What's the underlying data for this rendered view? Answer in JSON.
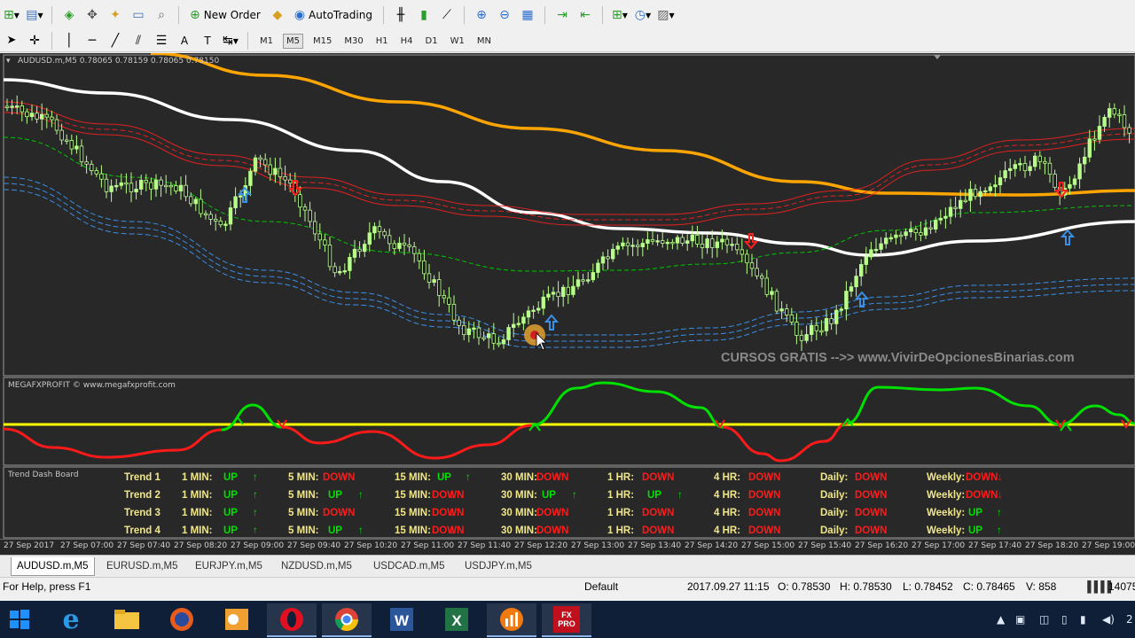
{
  "toolbar": {
    "new_order_label": "New Order",
    "autotrading_label": "AutoTrading",
    "timeframes": [
      "M1",
      "M5",
      "M15",
      "M30",
      "H1",
      "H4",
      "D1",
      "W1",
      "MN"
    ],
    "active_timeframe": "M5"
  },
  "chart": {
    "header": "AUDUSD.m,M5  0.78065 0.78159 0.78065 0.78150",
    "watermark": "CURSOS GRATIS -->> www.VivirDeOpcionesBinarias.com"
  },
  "indicator": {
    "label": "MEGAFXPROFIT © www.megafxprofit.com"
  },
  "dashboard": {
    "title": "Trend Dash Board",
    "period_labels": [
      "1 MIN:",
      "5 MIN:",
      "15 MIN:",
      "30 MIN:",
      "1 HR:",
      "4 HR:",
      "Daily:",
      "Weekly:"
    ],
    "rows": [
      {
        "name": "Trend 1",
        "values": [
          "UP",
          "DOWN",
          "UP",
          "DOWN",
          "DOWN",
          "DOWN",
          "DOWN",
          "DOWN"
        ]
      },
      {
        "name": "Trend 2",
        "values": [
          "UP",
          "UP",
          "DOWN",
          "UP",
          "UP",
          "DOWN",
          "DOWN",
          "DOWN"
        ]
      },
      {
        "name": "Trend 3",
        "values": [
          "UP",
          "DOWN",
          "DOWN",
          "DOWN",
          "DOWN",
          "DOWN",
          "DOWN",
          "UP"
        ]
      },
      {
        "name": "Trend 4",
        "values": [
          "UP",
          "UP",
          "DOWN",
          "DOWN",
          "DOWN",
          "DOWN",
          "DOWN",
          "UP"
        ]
      }
    ]
  },
  "xaxis_labels": [
    "27 Sep 2017",
    "27 Sep 07:00",
    "27 Sep 07:40",
    "27 Sep 08:20",
    "27 Sep 09:00",
    "27 Sep 09:40",
    "27 Sep 10:20",
    "27 Sep 11:00",
    "27 Sep 11:40",
    "27 Sep 12:20",
    "27 Sep 13:00",
    "27 Sep 13:40",
    "27 Sep 14:20",
    "27 Sep 15:00",
    "27 Sep 15:40",
    "27 Sep 16:20",
    "27 Sep 17:00",
    "27 Sep 17:40",
    "27 Sep 18:20",
    "27 Sep 19:00"
  ],
  "tabs": [
    "AUDUSD.m,M5",
    "EURUSD.m,M5",
    "EURJPY.m,M5",
    "NZDUSD.m,M5",
    "USDCAD.m,M5",
    "USDJPY.m,M5"
  ],
  "active_tab": "AUDUSD.m,M5",
  "status": {
    "help": "For Help, press F1",
    "profile": "Default",
    "datetime": "2017.09.27 11:15",
    "open": "O: 0.78530",
    "high": "H: 0.78530",
    "low": "L: 0.78452",
    "close": "C: 0.78465",
    "volume": "V: 858",
    "traffic": "14075"
  },
  "taskbar": {
    "apps": [
      "start-button",
      "internet-explorer-icon",
      "file-explorer-icon",
      "firefox-icon",
      "outlook-icon",
      "opera-icon",
      "chrome-icon",
      "word-icon",
      "excel-icon",
      "metatrader-icon",
      "fxpro-icon"
    ],
    "fxpro_label": "FX PRO",
    "clock_fragment": "2"
  },
  "colors": {
    "chart_bg": "#282828",
    "bull_candle": "#b8ff8a",
    "ema_white": "#ffffff",
    "ema_orange": "#ffa500",
    "band_red": "#ff2020",
    "band_blue": "#3a8fe6",
    "band_green": "#00c800",
    "osc_up": "#00e000",
    "osc_down": "#ff1a1a",
    "zero_line": "#ffff00"
  }
}
